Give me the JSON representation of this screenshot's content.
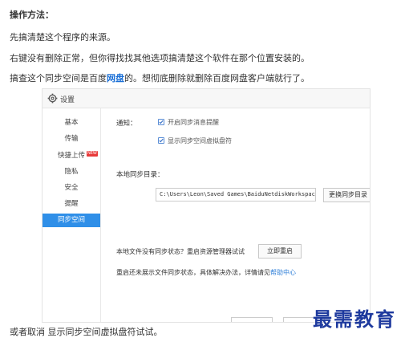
{
  "article": {
    "title": "操作方法：",
    "p1": "先搞清楚这个程序的来源。",
    "p2": "右键没有删除正常，但你得找找其他选项搞清楚这个软件在那个位置安装的。",
    "p3_before": "搞查这个同步空间是百度",
    "p3_link": "网盘",
    "p3_after": "的。想彻底删除就删除百度网盘客户端就行了。",
    "footer": "或者取消 显示同步空间虚拟盘符试试。"
  },
  "window": {
    "title": "设置",
    "sidebar": [
      {
        "label": "基本"
      },
      {
        "label": "传输"
      },
      {
        "label": "快捷上传"
      },
      {
        "label": "隐私"
      },
      {
        "label": "安全"
      },
      {
        "label": "提醒"
      },
      {
        "label": "同步空间"
      }
    ],
    "new_badge": "NEW",
    "notify_label": "通知：",
    "checkbox1": "开启同步消息提醒",
    "checkbox2": "显示同步空间虚拟盘符",
    "dir_label": "本地同步目录：",
    "dir_value": "C:\\Users\\Leon\\Saved Games\\BaiduNetdiskWorkspace",
    "change_dir": "更换同步目录",
    "status_question": "本地文件没有同步状态？重启资源管理器试试",
    "restart": "立即重启",
    "help_before": "重启还未展示文件同步状态，具体解决办法，详情请见",
    "help_link": "帮助中心"
  },
  "watermark": "最需教育",
  "colors": {
    "accent": "#2f8fe8",
    "link": "#1a6fd6",
    "watermark": "#1e3a9e"
  }
}
